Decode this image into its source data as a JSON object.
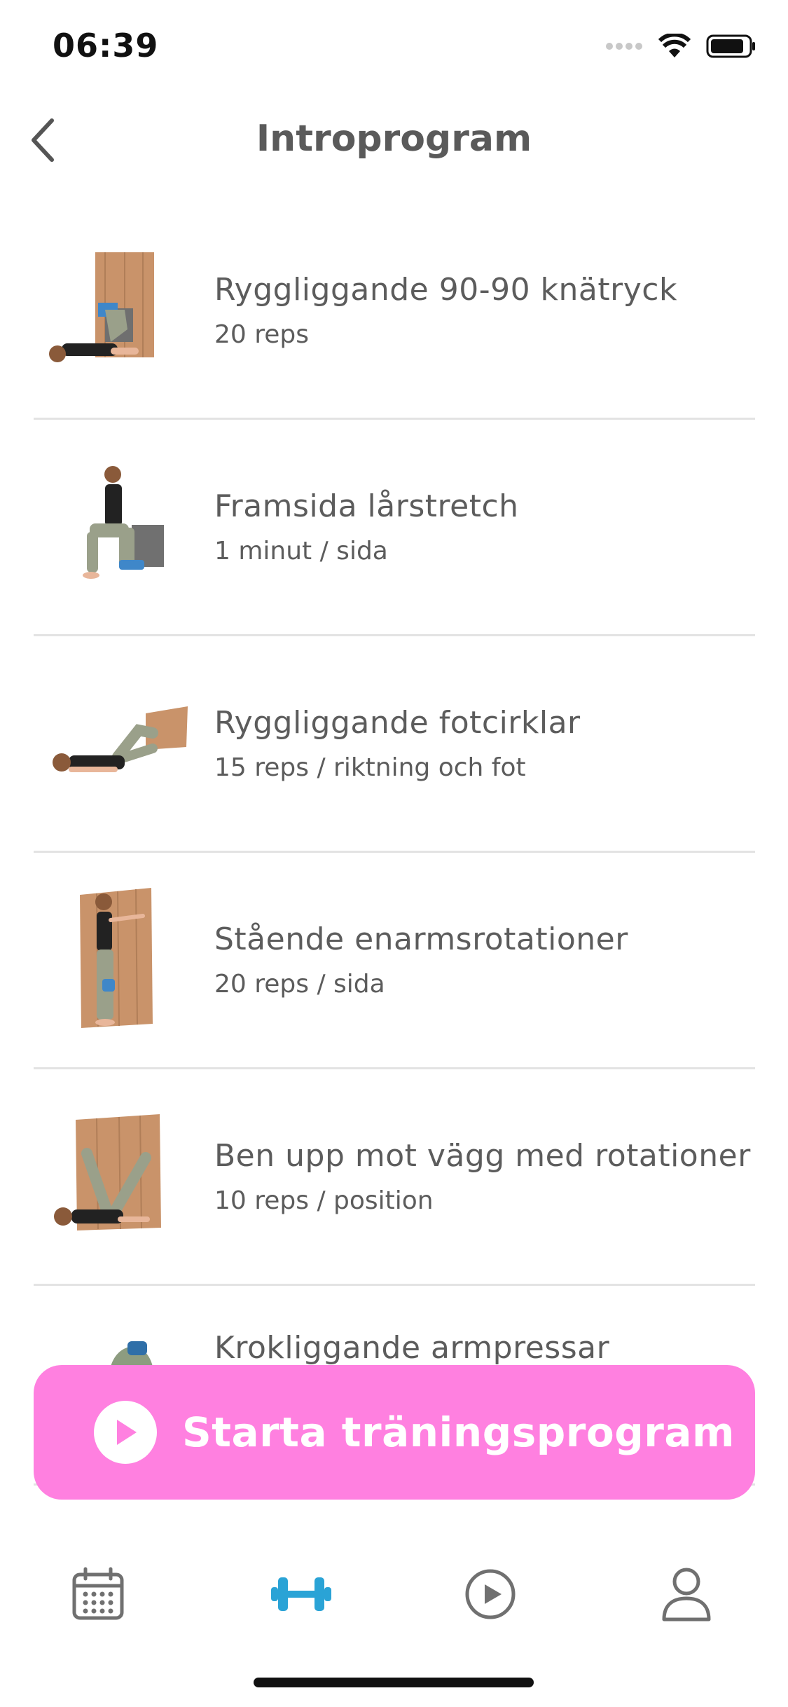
{
  "status_bar": {
    "time": "06:39"
  },
  "header": {
    "title": "Introprogram"
  },
  "exercises": [
    {
      "title": "Ryggliggande 90-90 knätryck",
      "subtitle": "20 reps"
    },
    {
      "title": "Framsida lårstretch",
      "subtitle": "1 minut / sida"
    },
    {
      "title": "Ryggliggande fotcirklar",
      "subtitle": "15 reps / riktning och fot"
    },
    {
      "title": "Stående enarmsrotationer",
      "subtitle": "20 reps / sida"
    },
    {
      "title": "Ben upp mot vägg med rotationer",
      "subtitle": "10 reps / position"
    },
    {
      "title": "Krokliggande armpressar",
      "subtitle": ""
    }
  ],
  "start_button": {
    "label": "Starta träningsprogram"
  },
  "tabs": [
    {
      "icon": "calendar-icon",
      "active": false
    },
    {
      "icon": "dumbbell-icon",
      "active": true
    },
    {
      "icon": "play-circle-icon",
      "active": false
    },
    {
      "icon": "profile-icon",
      "active": false
    }
  ],
  "colors": {
    "accent": "#ff80e0",
    "active_tab": "#2aa3d6",
    "text": "#5c5c5c",
    "divider": "#e3e3e3"
  }
}
